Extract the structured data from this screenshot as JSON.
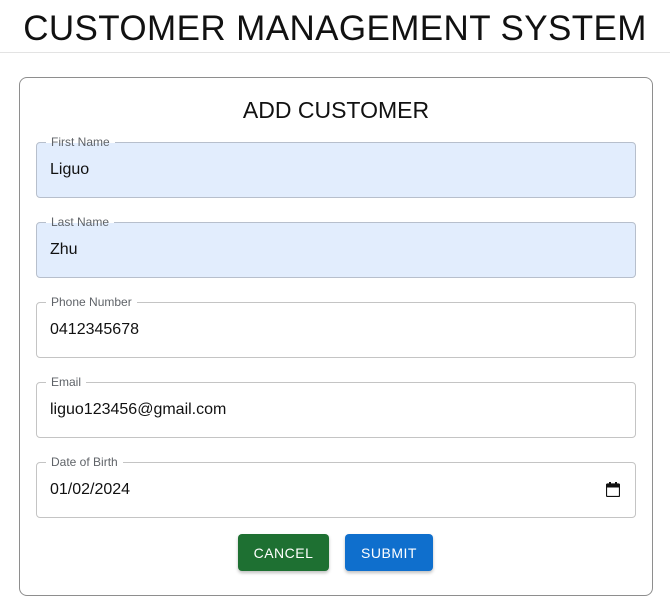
{
  "header": {
    "title": "CUSTOMER MANAGEMENT SYSTEM"
  },
  "form": {
    "title": "ADD CUSTOMER",
    "fields": [
      {
        "label": "First Name",
        "value": "Liguo"
      },
      {
        "label": "Last Name",
        "value": "Zhu"
      },
      {
        "label": "Phone Number",
        "value": "0412345678"
      },
      {
        "label": "Email",
        "value": "liguo123456@gmail.com"
      },
      {
        "label": "Date of Birth",
        "value": "01/02/2024"
      }
    ],
    "buttons": {
      "cancel": "CANCEL",
      "submit": "SUBMIT"
    }
  },
  "colors": {
    "autofill_background": "#e2edfd",
    "cancel_button": "#1e7032",
    "submit_button": "#0f6fcd"
  },
  "icons": {
    "date_picker": "calendar-icon"
  }
}
